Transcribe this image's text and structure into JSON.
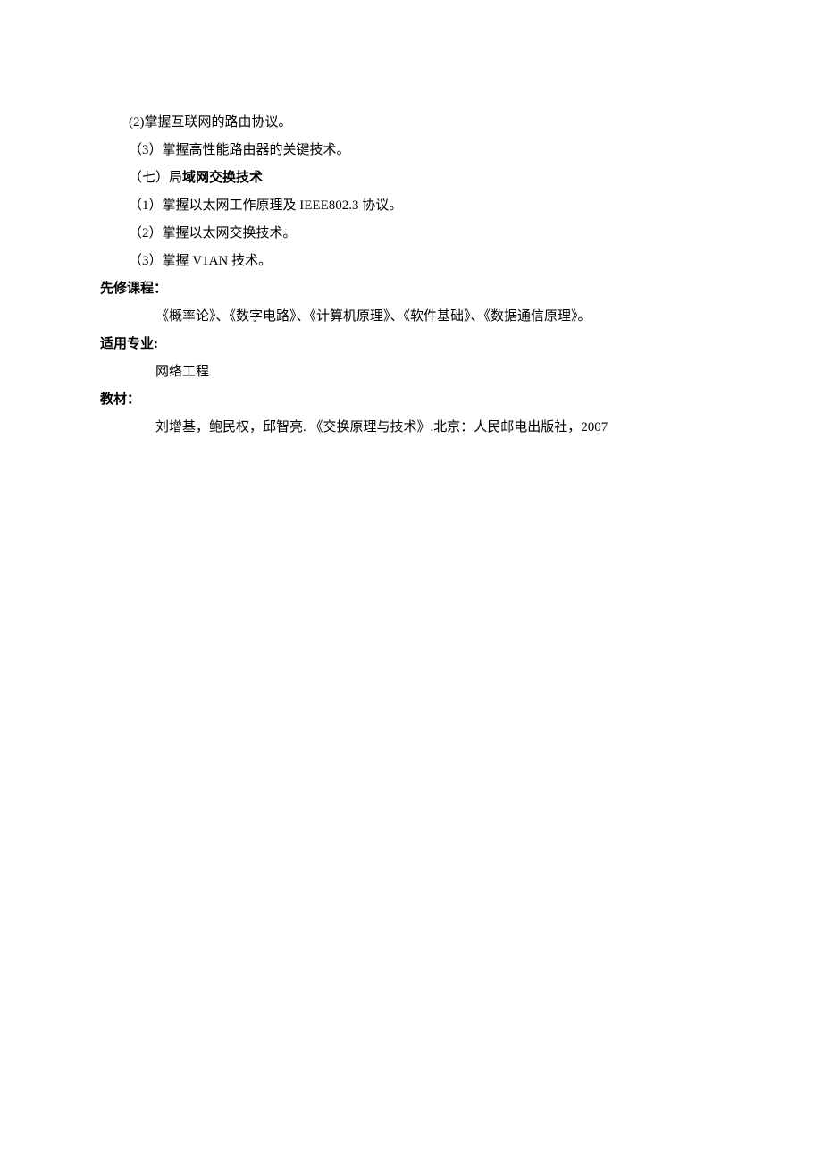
{
  "lines": {
    "item_6_2": "(2)掌握互联网的路由协议。",
    "item_6_3": "（3）掌握高性能路由器的关键技术。",
    "section_7_prefix": "（七）局",
    "section_7_bold": "域网交换技术",
    "item_7_1": "（1）掌握以太网工作原理及 IEEE802.3 协议。",
    "item_7_2": "（2）掌握以太网交换技术。",
    "item_7_3": "（3）掌握 V1AN 技术。",
    "prereq_heading": "先修课程：",
    "prereq_content": "《概率论》、《数字电路》、《计算机原理》、《软件基础》、《数据通信原理》。",
    "major_heading": "适用专业:",
    "major_content": "网络工程",
    "textbook_heading": "教材：",
    "textbook_content": "刘增基，鲍民权，邱智亮. 《交换原理与技术》.北京：人民邮电出版社，2007"
  }
}
